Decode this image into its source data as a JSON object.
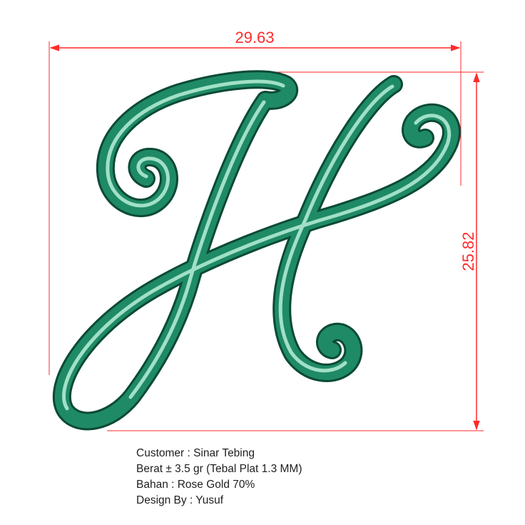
{
  "dimensions": {
    "width": "29.63",
    "height": "25.82"
  },
  "info": {
    "customer": "Customer : Sinar Tebing",
    "weight": "Berat ± 3.5 gr (Tebal Plat 1.3 MM)",
    "material": "Bahan : Rose Gold 70%",
    "designer": "Design By : Yusuf"
  },
  "colors": {
    "dimension": "#ff2a2a",
    "letter_dark": "#0b4a36",
    "letter_mid": "#1f8a66",
    "letter_light": "#b8f0d8",
    "text": "#1f1f1f"
  }
}
